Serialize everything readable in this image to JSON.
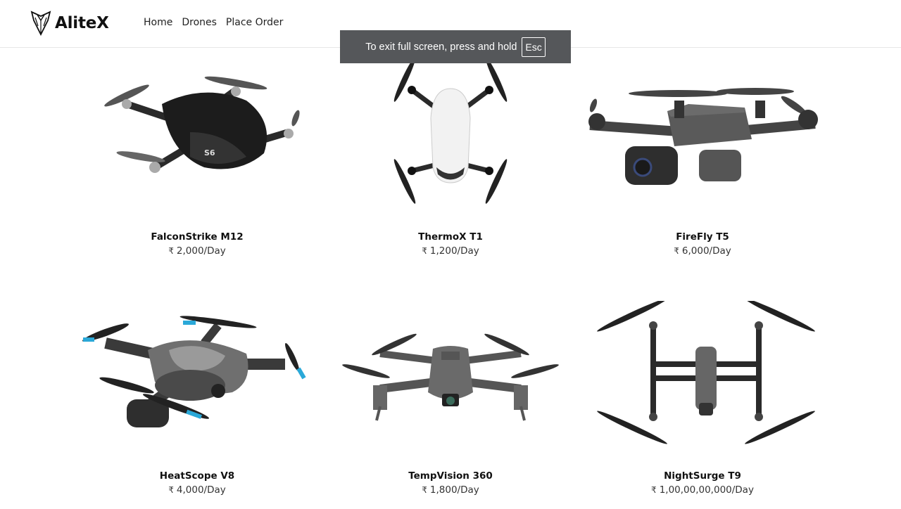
{
  "browser": {
    "fullscreen_toast_text": "To exit full screen, press and hold",
    "fullscreen_toast_key": "Esc"
  },
  "brand": {
    "name": "AliteX"
  },
  "nav": {
    "items": [
      {
        "label": "Home"
      },
      {
        "label": "Drones"
      },
      {
        "label": "Place Order"
      }
    ]
  },
  "currency_symbol": "₹",
  "products": [
    {
      "name": "FalconStrike M12",
      "price": "2,000/Day",
      "icon": "drone-falconstrike-image"
    },
    {
      "name": "ThermoX T1",
      "price": "1,200/Day",
      "icon": "drone-thermox-image"
    },
    {
      "name": "FireFly T5",
      "price": "6,000/Day",
      "icon": "drone-firefly-image"
    },
    {
      "name": "HeatScope V8",
      "price": "4,000/Day",
      "icon": "drone-heatscope-image"
    },
    {
      "name": "TempVision 360",
      "price": "1,800/Day",
      "icon": "drone-tempvision-image"
    },
    {
      "name": "NightSurge T9",
      "price": "1,00,00,00,000/Day",
      "icon": "drone-nightsurge-image"
    }
  ]
}
